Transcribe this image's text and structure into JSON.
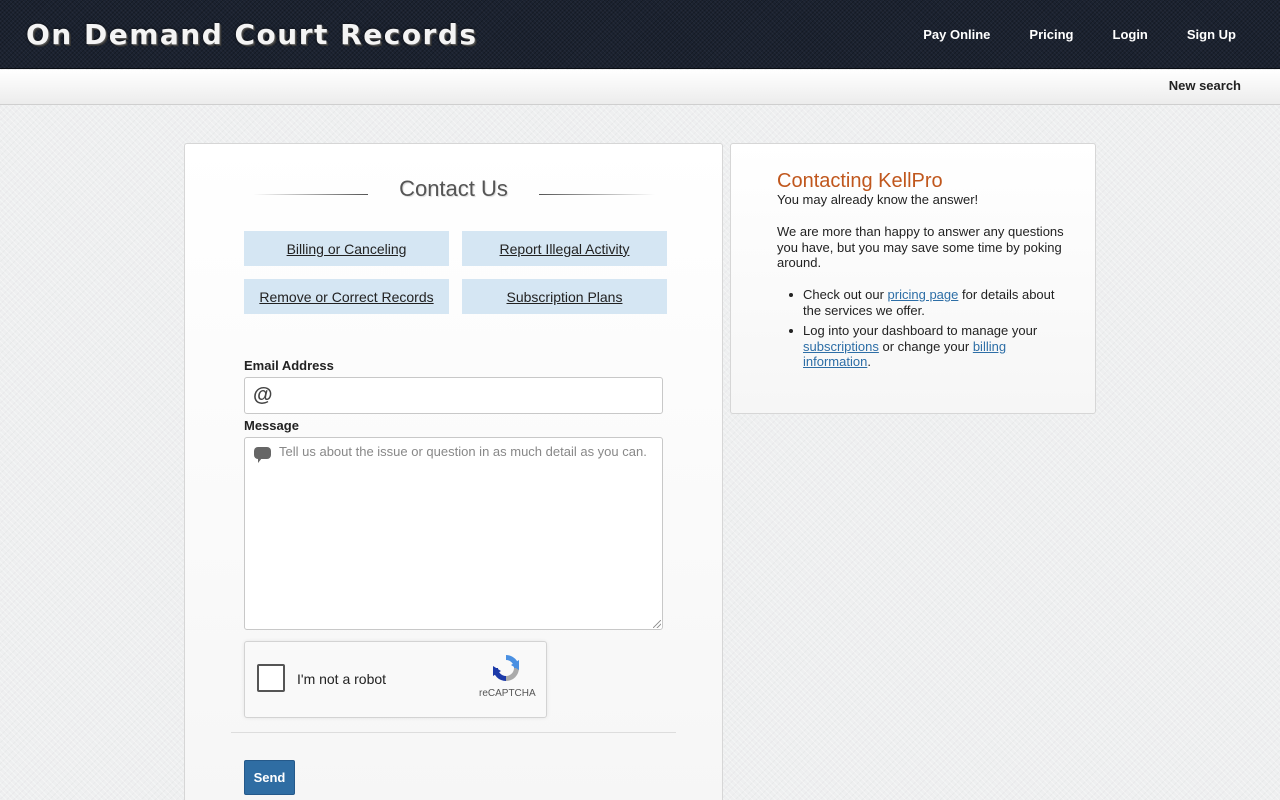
{
  "header": {
    "logo": "On Demand Court Records",
    "nav": [
      "Pay Online",
      "Pricing",
      "Login",
      "Sign Up"
    ],
    "subnav_link": "New search"
  },
  "contact": {
    "title": "Contact Us",
    "topics": [
      "Billing or Canceling",
      "Report Illegal Activity",
      "Remove or Correct Records",
      "Subscription Plans"
    ],
    "email_label": "Email Address",
    "email_value": "",
    "message_label": "Message",
    "message_placeholder": "Tell us about the issue or question in as much detail as you can.",
    "captcha_text": "I'm not a robot",
    "captcha_brand": "reCAPTCHA",
    "send_label": "Send"
  },
  "sidebar": {
    "title": "Contacting KellPro",
    "intro": "You may already know the answer!",
    "paragraph": "We are more than happy to answer any questions you have, but you may save some time by poking around.",
    "item1_before": "Check out our ",
    "item1_link": "pricing page",
    "item1_after": " for details about the services we offer.",
    "item2_before": "Log into your dashboard to manage your ",
    "item2_link1": "subscriptions",
    "item2_middle": " or change your ",
    "item2_link2": "billing information",
    "item2_after": "."
  },
  "colors": {
    "header_bg": "#1b2230",
    "topic_button_bg": "#d5e6f3",
    "sidebar_title": "#c0571d",
    "send_button": "#2f6da3",
    "link": "#2d6ea6"
  }
}
